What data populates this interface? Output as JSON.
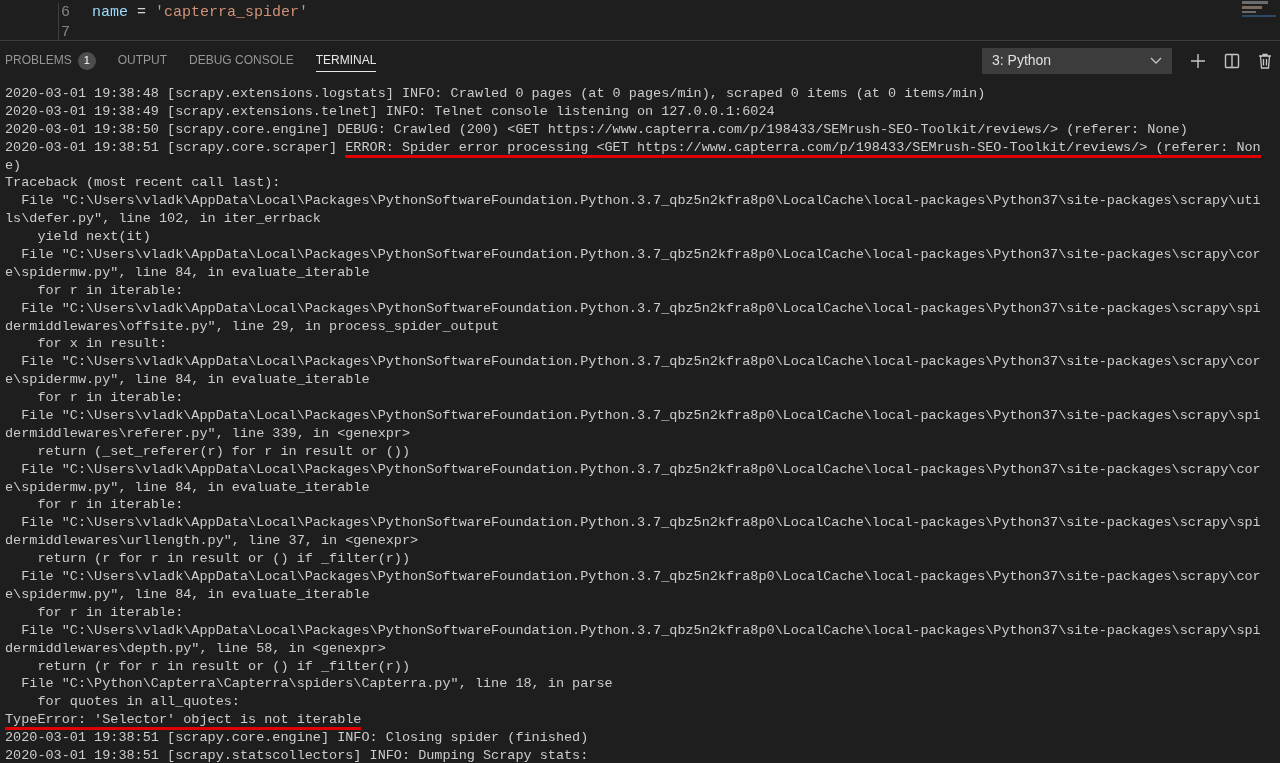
{
  "editor": {
    "lines": [
      {
        "number": "6",
        "tokens": [
          {
            "text": "name",
            "kind": "variable"
          },
          {
            "text": " = ",
            "kind": "operator"
          },
          {
            "text": "'capterra_spider'",
            "kind": "string"
          }
        ]
      },
      {
        "number": "7"
      }
    ]
  },
  "panel": {
    "tabs": [
      {
        "label": "PROBLEMS",
        "badge": "1",
        "selected": false
      },
      {
        "label": "OUTPUT",
        "selected": false
      },
      {
        "label": "DEBUG CONSOLE",
        "selected": false
      },
      {
        "label": "TERMINAL",
        "selected": true
      }
    ],
    "terminal_select": {
      "value": "3: Python"
    }
  },
  "terminal": {
    "lines": [
      {
        "text": "2020-03-01 19:38:48 [scrapy.extensions.logstats] INFO: Crawled 0 pages (at 0 pages/min), scraped 0 items (at 0 items/min)"
      },
      {
        "text": "2020-03-01 19:38:49 [scrapy.extensions.telnet] INFO: Telnet console listening on 127.0.0.1:6024"
      },
      {
        "text": "2020-03-01 19:38:50 [scrapy.core.engine] DEBUG: Crawled (200) <GET https://www.capterra.com/p/198433/SEMrush-SEO-Toolkit/reviews/> (referer: None)"
      },
      {
        "text": "2020-03-01 19:38:51 [scrapy.core.scraper] ",
        "flagged": "ERROR: Spider error processing <GET https://www.capterra.com/p/198433/SEMrush-SEO-Toolkit/reviews/> (referer: Non"
      },
      {
        "text": "e)"
      },
      {
        "text": "Traceback (most recent call last):"
      },
      {
        "text": "  File \"C:\\Users\\vladk\\AppData\\Local\\Packages\\PythonSoftwareFoundation.Python.3.7_qbz5n2kfra8p0\\LocalCache\\local-packages\\Python37\\site-packages\\scrapy\\uti"
      },
      {
        "text": "ls\\defer.py\", line 102, in iter_errback"
      },
      {
        "text": "    yield next(it)"
      },
      {
        "text": "  File \"C:\\Users\\vladk\\AppData\\Local\\Packages\\PythonSoftwareFoundation.Python.3.7_qbz5n2kfra8p0\\LocalCache\\local-packages\\Python37\\site-packages\\scrapy\\cor"
      },
      {
        "text": "e\\spidermw.py\", line 84, in evaluate_iterable"
      },
      {
        "text": "    for r in iterable:"
      },
      {
        "text": "  File \"C:\\Users\\vladk\\AppData\\Local\\Packages\\PythonSoftwareFoundation.Python.3.7_qbz5n2kfra8p0\\LocalCache\\local-packages\\Python37\\site-packages\\scrapy\\spi"
      },
      {
        "text": "dermiddlewares\\offsite.py\", line 29, in process_spider_output"
      },
      {
        "text": "    for x in result:"
      },
      {
        "text": "  File \"C:\\Users\\vladk\\AppData\\Local\\Packages\\PythonSoftwareFoundation.Python.3.7_qbz5n2kfra8p0\\LocalCache\\local-packages\\Python37\\site-packages\\scrapy\\cor"
      },
      {
        "text": "e\\spidermw.py\", line 84, in evaluate_iterable"
      },
      {
        "text": "    for r in iterable:"
      },
      {
        "text": "  File \"C:\\Users\\vladk\\AppData\\Local\\Packages\\PythonSoftwareFoundation.Python.3.7_qbz5n2kfra8p0\\LocalCache\\local-packages\\Python37\\site-packages\\scrapy\\spi"
      },
      {
        "text": "dermiddlewares\\referer.py\", line 339, in <genexpr>"
      },
      {
        "text": "    return (_set_referer(r) for r in result or ())"
      },
      {
        "text": "  File \"C:\\Users\\vladk\\AppData\\Local\\Packages\\PythonSoftwareFoundation.Python.3.7_qbz5n2kfra8p0\\LocalCache\\local-packages\\Python37\\site-packages\\scrapy\\cor"
      },
      {
        "text": "e\\spidermw.py\", line 84, in evaluate_iterable"
      },
      {
        "text": "    for r in iterable:"
      },
      {
        "text": "  File \"C:\\Users\\vladk\\AppData\\Local\\Packages\\PythonSoftwareFoundation.Python.3.7_qbz5n2kfra8p0\\LocalCache\\local-packages\\Python37\\site-packages\\scrapy\\spi"
      },
      {
        "text": "dermiddlewares\\urllength.py\", line 37, in <genexpr>"
      },
      {
        "text": "    return (r for r in result or () if _filter(r))"
      },
      {
        "text": "  File \"C:\\Users\\vladk\\AppData\\Local\\Packages\\PythonSoftwareFoundation.Python.3.7_qbz5n2kfra8p0\\LocalCache\\local-packages\\Python37\\site-packages\\scrapy\\cor"
      },
      {
        "text": "e\\spidermw.py\", line 84, in evaluate_iterable"
      },
      {
        "text": "    for r in iterable:"
      },
      {
        "text": "  File \"C:\\Users\\vladk\\AppData\\Local\\Packages\\PythonSoftwareFoundation.Python.3.7_qbz5n2kfra8p0\\LocalCache\\local-packages\\Python37\\site-packages\\scrapy\\spi"
      },
      {
        "text": "dermiddlewares\\depth.py\", line 58, in <genexpr>"
      },
      {
        "text": "    return (r for r in result or () if _filter(r))"
      },
      {
        "text": "  File \"C:\\Python\\Capterra\\Capterra\\spiders\\Capterra.py\", line 18, in parse"
      },
      {
        "text": "    for quotes in all_quotes:"
      },
      {
        "flagged": "TypeError: 'Selector' object is not iterable"
      },
      {
        "text": "2020-03-01 19:38:51 [scrapy.core.engine] INFO: Closing spider (finished)"
      },
      {
        "text": "2020-03-01 19:38:51 [scrapy.statscollectors] INFO: Dumping Scrapy stats:"
      }
    ]
  }
}
